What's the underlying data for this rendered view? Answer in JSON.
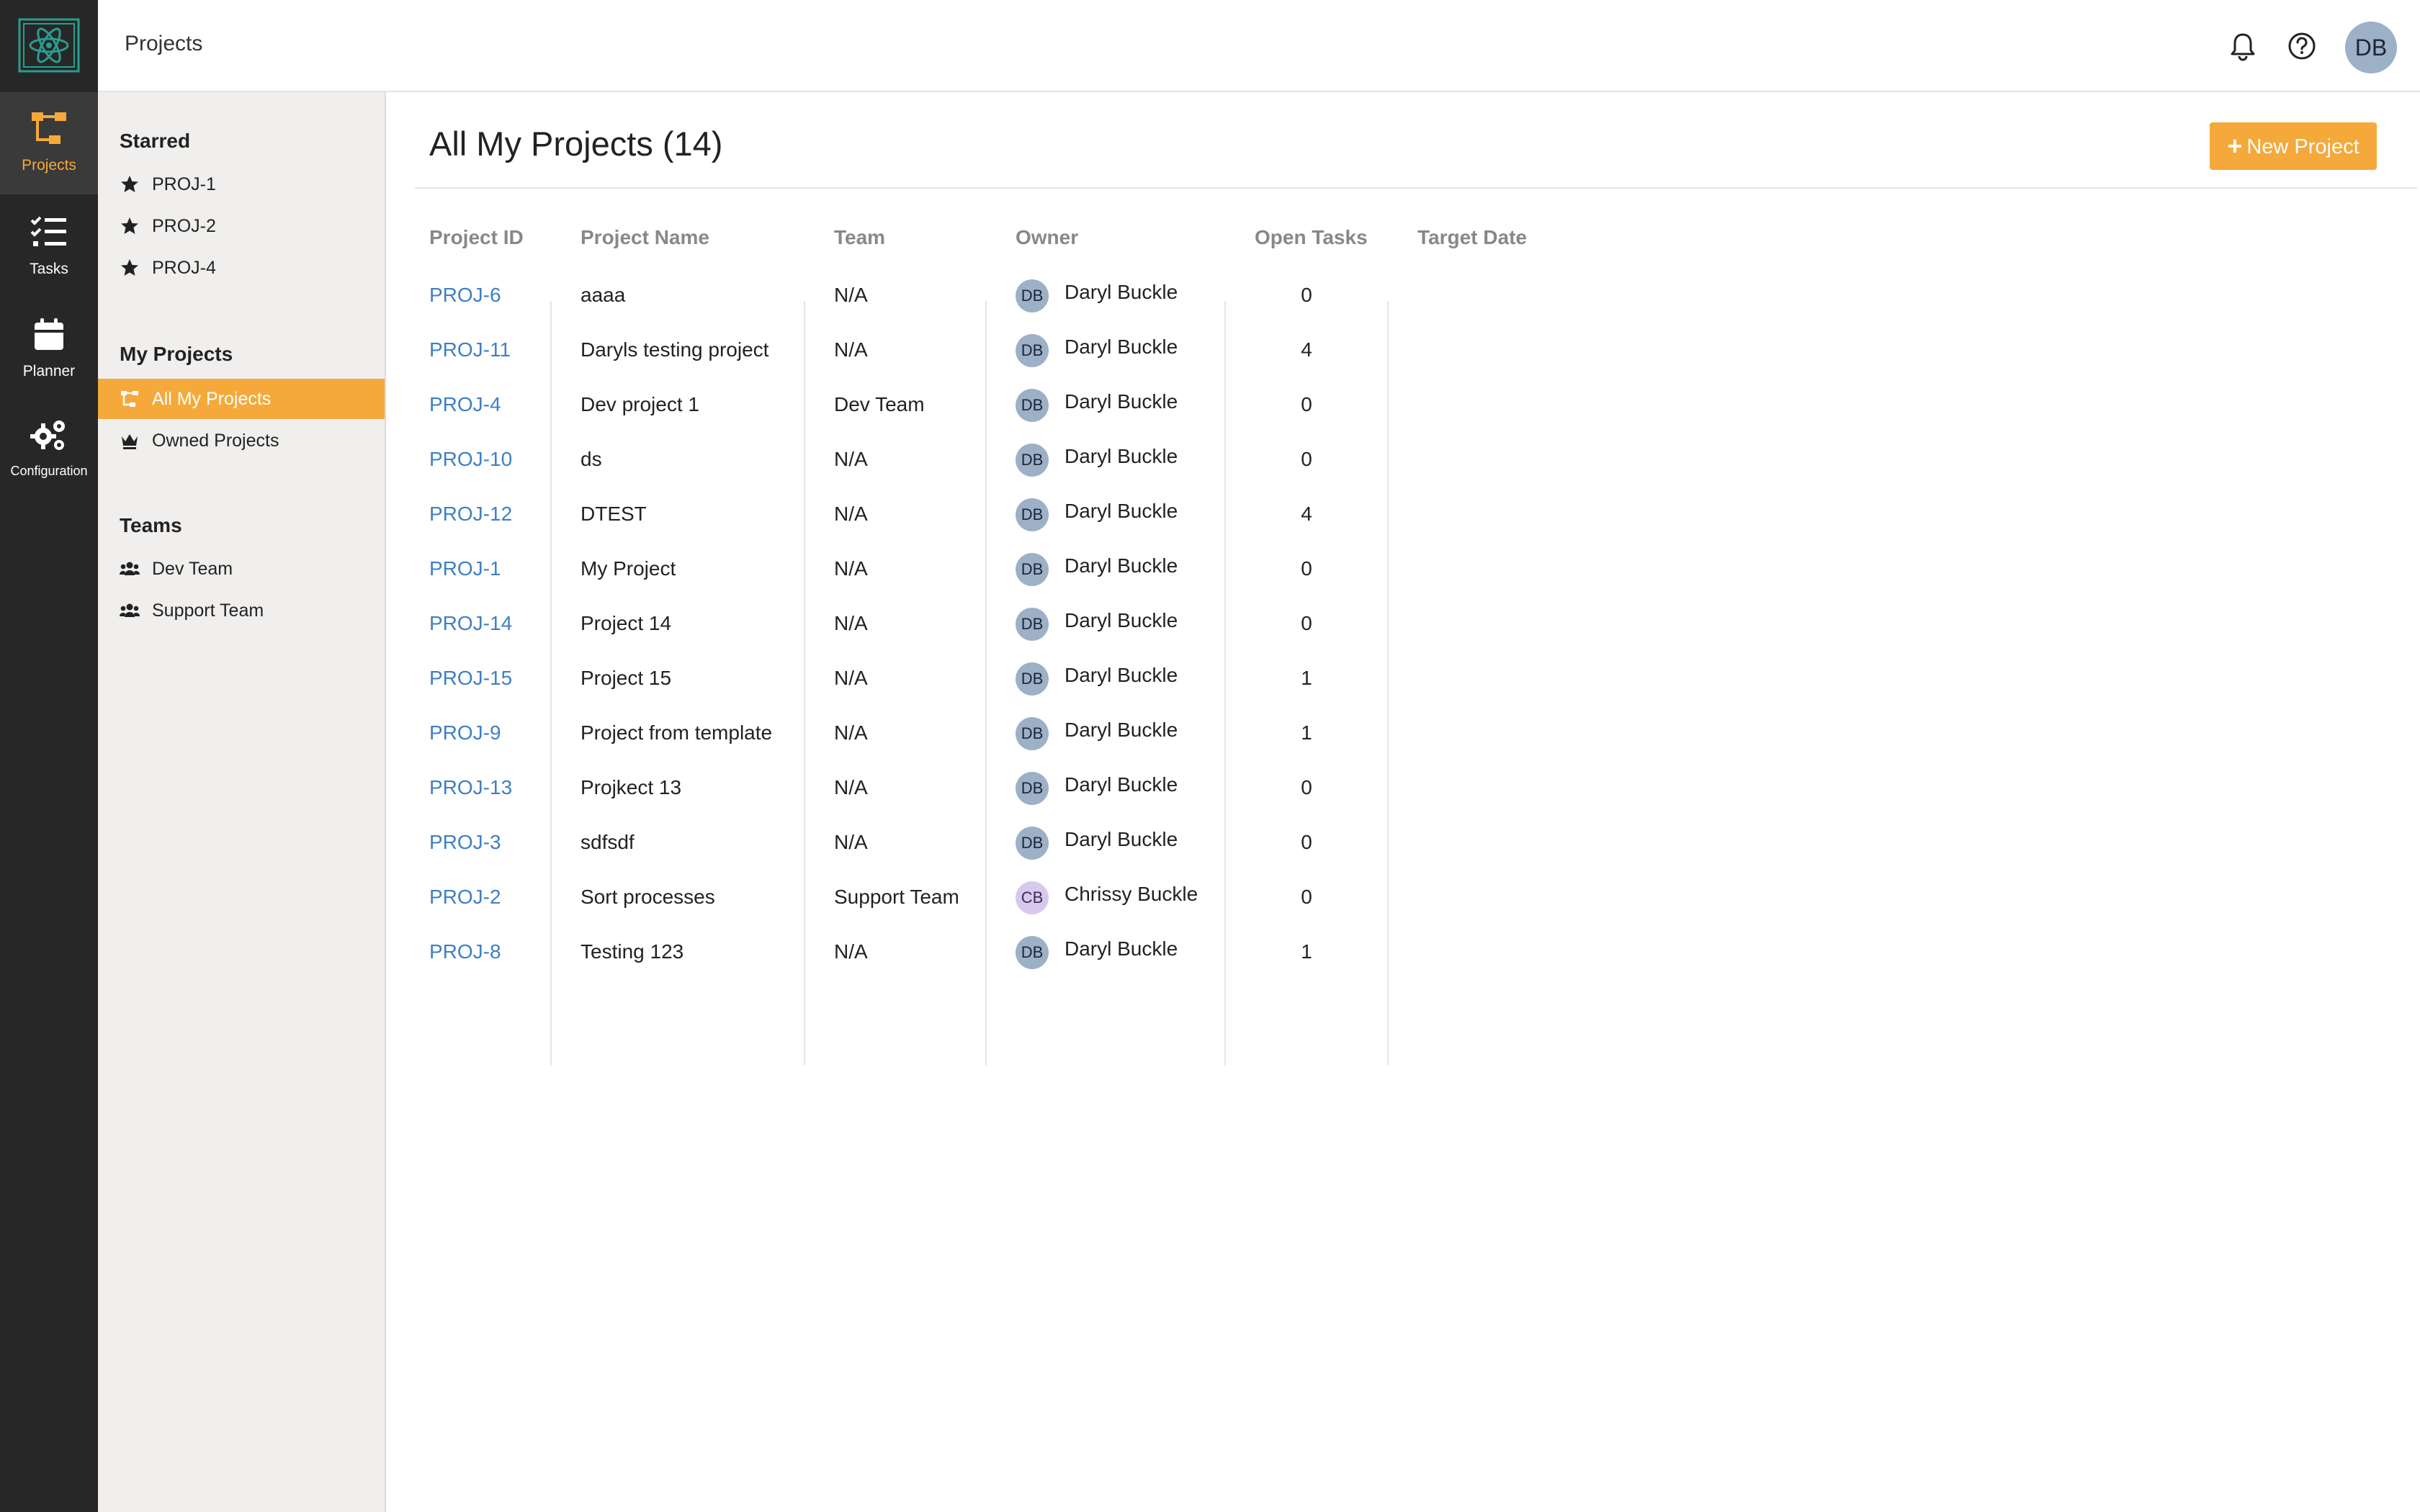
{
  "rail": {
    "items": [
      {
        "label": "Projects",
        "icon": "projects-icon"
      },
      {
        "label": "Tasks",
        "icon": "tasks-icon"
      },
      {
        "label": "Planner",
        "icon": "calendar-icon"
      },
      {
        "label": "Configuration",
        "icon": "gears-icon"
      }
    ]
  },
  "topbar": {
    "breadcrumb": "Projects",
    "avatar_initials": "DB"
  },
  "sidebar": {
    "starred_heading": "Starred",
    "starred": [
      {
        "label": "PROJ-1"
      },
      {
        "label": "PROJ-2"
      },
      {
        "label": "PROJ-4"
      }
    ],
    "my_projects_heading": "My Projects",
    "my_projects": [
      {
        "label": "All My Projects"
      },
      {
        "label": "Owned Projects"
      }
    ],
    "teams_heading": "Teams",
    "teams": [
      {
        "label": "Dev Team"
      },
      {
        "label": "Support Team"
      }
    ]
  },
  "main": {
    "title": "All My Projects (14)",
    "new_button": "New Project",
    "plus_glyph": "+",
    "columns": [
      "Project ID",
      "Project Name",
      "Team",
      "Owner",
      "Open Tasks",
      "Target Date"
    ],
    "rows": [
      {
        "id": "PROJ-6",
        "name": "aaaa",
        "team": "N/A",
        "owner_initials": "DB",
        "owner": "Daryl Buckle",
        "open": "0",
        "target": ""
      },
      {
        "id": "PROJ-11",
        "name": "Daryls testing project",
        "team": "N/A",
        "owner_initials": "DB",
        "owner": "Daryl Buckle",
        "open": "4",
        "target": ""
      },
      {
        "id": "PROJ-4",
        "name": "Dev project 1",
        "team": "Dev Team",
        "owner_initials": "DB",
        "owner": "Daryl Buckle",
        "open": "0",
        "target": ""
      },
      {
        "id": "PROJ-10",
        "name": "ds",
        "team": "N/A",
        "owner_initials": "DB",
        "owner": "Daryl Buckle",
        "open": "0",
        "target": ""
      },
      {
        "id": "PROJ-12",
        "name": "DTEST",
        "team": "N/A",
        "owner_initials": "DB",
        "owner": "Daryl Buckle",
        "open": "4",
        "target": ""
      },
      {
        "id": "PROJ-1",
        "name": "My Project",
        "team": "N/A",
        "owner_initials": "DB",
        "owner": "Daryl Buckle",
        "open": "0",
        "target": ""
      },
      {
        "id": "PROJ-14",
        "name": "Project 14",
        "team": "N/A",
        "owner_initials": "DB",
        "owner": "Daryl Buckle",
        "open": "0",
        "target": ""
      },
      {
        "id": "PROJ-15",
        "name": "Project 15",
        "team": "N/A",
        "owner_initials": "DB",
        "owner": "Daryl Buckle",
        "open": "1",
        "target": ""
      },
      {
        "id": "PROJ-9",
        "name": "Project from template",
        "team": "N/A",
        "owner_initials": "DB",
        "owner": "Daryl Buckle",
        "open": "1",
        "target": ""
      },
      {
        "id": "PROJ-13",
        "name": "Projkect 13",
        "team": "N/A",
        "owner_initials": "DB",
        "owner": "Daryl Buckle",
        "open": "0",
        "target": ""
      },
      {
        "id": "PROJ-3",
        "name": "sdfsdf",
        "team": "N/A",
        "owner_initials": "DB",
        "owner": "Daryl Buckle",
        "open": "0",
        "target": ""
      },
      {
        "id": "PROJ-2",
        "name": "Sort processes",
        "team": "Support Team",
        "owner_initials": "CB",
        "owner": "Chrissy Buckle",
        "open": "0",
        "target": ""
      },
      {
        "id": "PROJ-8",
        "name": "Testing 123",
        "team": "N/A",
        "owner_initials": "DB",
        "owner": "Daryl Buckle",
        "open": "1",
        "target": ""
      }
    ]
  },
  "colors": {
    "accent": "#f5a93a",
    "link": "#3e7fc5",
    "rail_bg": "#272727",
    "panel_bg": "#f0efee",
    "logo_teal": "#2a9d8f"
  }
}
